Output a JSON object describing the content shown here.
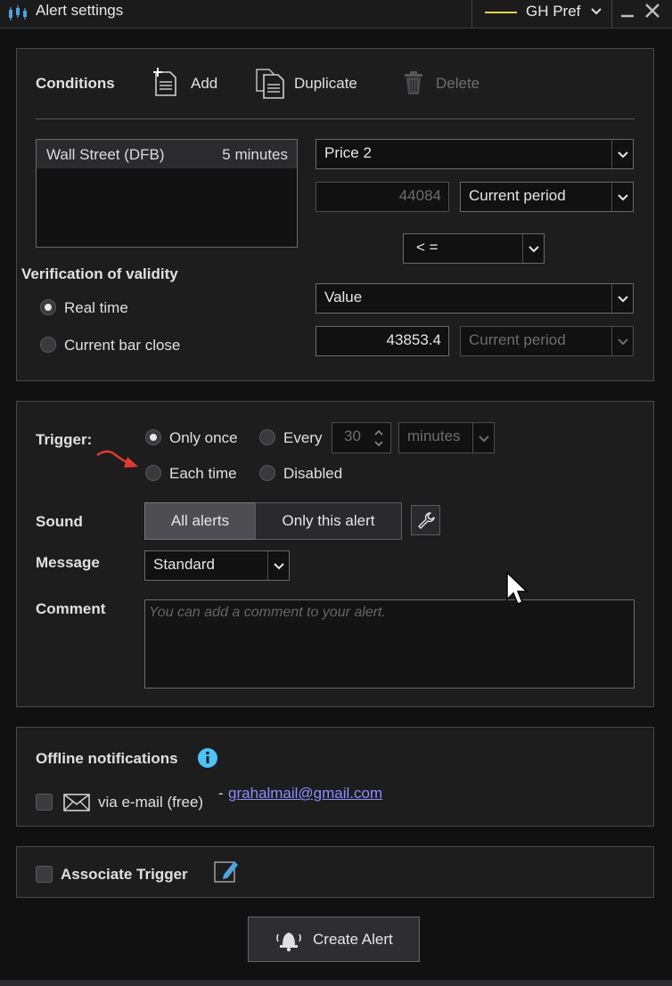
{
  "window": {
    "title": "Alert settings",
    "preference_label": "GH Pref"
  },
  "conditions": {
    "heading": "Conditions",
    "add_label": "Add",
    "duplicate_label": "Duplicate",
    "delete_label": "Delete",
    "instrument": "Wall Street (DFB)",
    "timeframe": "5 minutes",
    "left_source": "Price 2",
    "left_value": "44084",
    "left_period": "Current period",
    "operator": "< =",
    "right_source": "Value",
    "right_value": "43853.4",
    "right_period": "Current period"
  },
  "validity": {
    "heading": "Verification of validity",
    "options": [
      "Real time",
      "Current bar close"
    ],
    "selected": "Real time"
  },
  "trigger": {
    "heading": "Trigger:",
    "only_once": "Only once",
    "every": "Every",
    "every_value": "30",
    "every_unit": "minutes",
    "each_time": "Each time",
    "disabled": "Disabled",
    "selected": "Only once"
  },
  "sound": {
    "heading": "Sound",
    "all_alerts": "All alerts",
    "only_this_alert": "Only this alert"
  },
  "message": {
    "heading": "Message",
    "value": "Standard"
  },
  "comment": {
    "heading": "Comment",
    "placeholder": "You can add a comment to your alert."
  },
  "offline": {
    "heading": "Offline notifications",
    "email_label": "via e-mail (free)",
    "separator": "-",
    "email_address": "grahalmail@gmail.com"
  },
  "associate": {
    "label": "Associate Trigger"
  },
  "create_button": "Create Alert",
  "colors": {
    "background": "#111112",
    "panel": "#1d1d1e",
    "accent_yellow": "#e7d34a",
    "info_blue": "#4fc3f7",
    "link": "#8c8cff",
    "annotation_arrow": "#e53935"
  }
}
